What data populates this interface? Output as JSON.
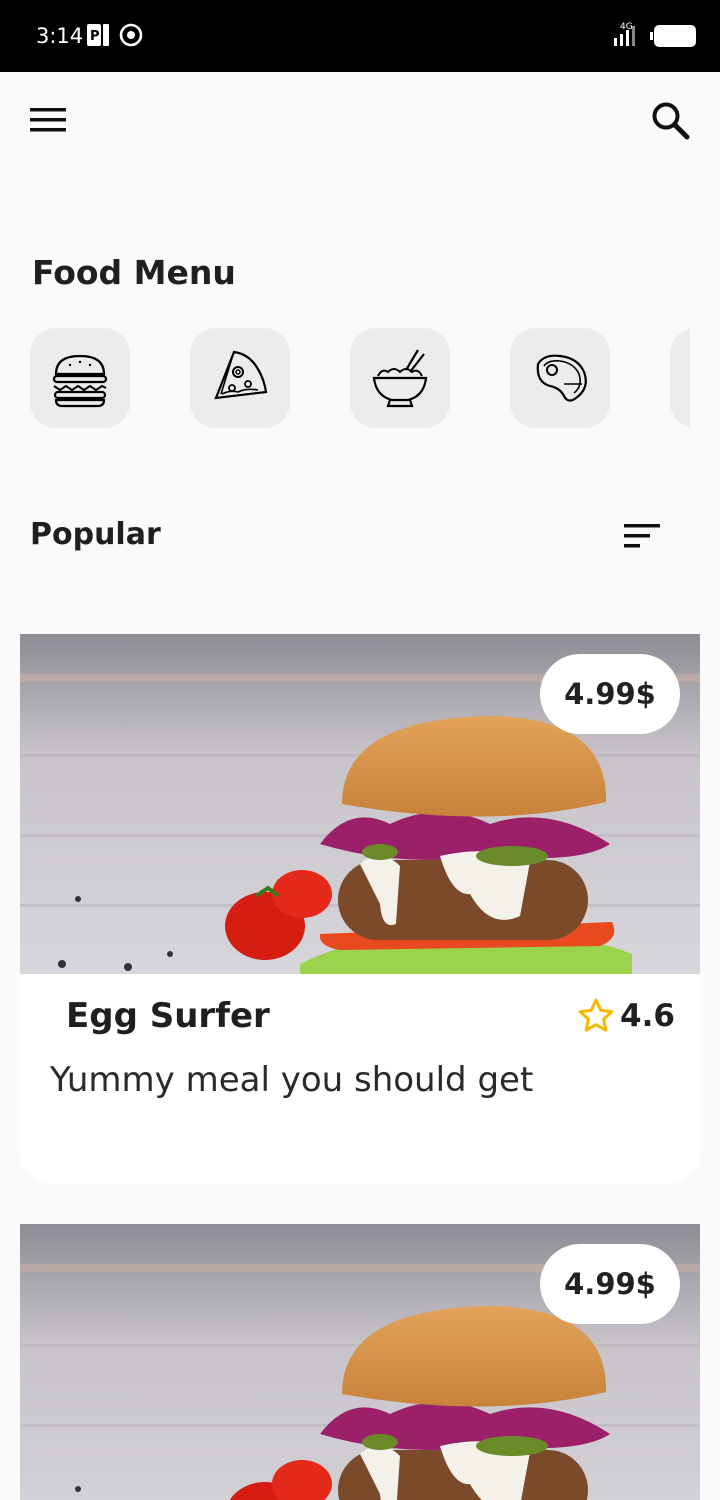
{
  "status_bar": {
    "time": "3:14",
    "network_label": "4G"
  },
  "header": {
    "menu_icon": "hamburger-icon",
    "search_icon": "search-icon"
  },
  "food_menu": {
    "title": "Food Menu",
    "categories": [
      {
        "icon": "burger-icon"
      },
      {
        "icon": "pizza-slice-icon"
      },
      {
        "icon": "noodle-bowl-icon"
      },
      {
        "icon": "steak-icon"
      },
      {
        "icon": "more-category-icon"
      }
    ]
  },
  "popular": {
    "title": "Popular",
    "sort_icon": "sort-icon",
    "items": [
      {
        "price": "4.99$",
        "name": "Egg Surfer",
        "rating": "4.6",
        "description": "Yummy meal you should get"
      },
      {
        "price": "4.99$",
        "name": "",
        "rating": "",
        "description": ""
      }
    ]
  },
  "colors": {
    "background": "#fafafa",
    "status_bar": "#000000",
    "category_tile": "#ececec",
    "star": "#f5b800",
    "text": "#1f1f1f"
  }
}
